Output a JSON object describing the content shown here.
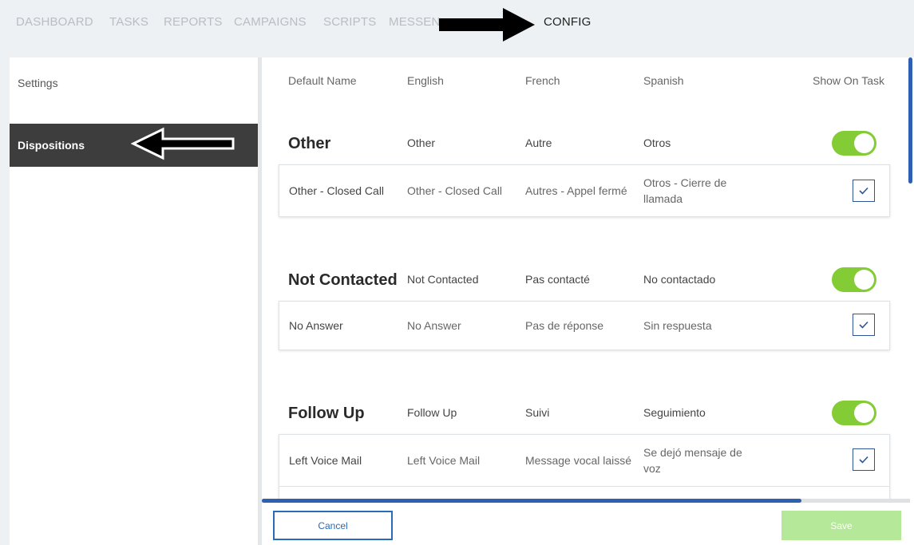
{
  "nav": {
    "items": [
      "DASHBOARD",
      "TASKS",
      "REPORTS",
      "CAMPAIGNS",
      "SCRIPTS",
      "MESSEN",
      "CONFIG"
    ]
  },
  "sidebar": {
    "items": [
      {
        "label": "Settings"
      },
      {
        "label": "Dispositions"
      }
    ]
  },
  "table": {
    "headers": [
      "Default Name",
      "English",
      "French",
      "Spanish",
      "Show On Task"
    ],
    "groups": [
      {
        "title": "Other",
        "english": "Other",
        "french": "Autre",
        "spanish": "Otros",
        "enabled": true,
        "rows": [
          {
            "name": "Other - Closed Call",
            "english": "Other - Closed Call",
            "french": "Autres - Appel fermé",
            "spanish": "Otros - Cierre de llamada",
            "checked": true
          }
        ]
      },
      {
        "title": "Not Contacted",
        "english": "Not Contacted",
        "french": "Pas contacté",
        "spanish": "No contactado",
        "enabled": true,
        "rows": [
          {
            "name": "No Answer",
            "english": "No Answer",
            "french": "Pas de réponse",
            "spanish": "Sin respuesta",
            "checked": true
          }
        ]
      },
      {
        "title": "Follow Up",
        "english": "Follow Up",
        "french": "Suivi",
        "spanish": "Seguimiento",
        "enabled": true,
        "rows": [
          {
            "name": "Left Voice Mail",
            "english": "Left Voice Mail",
            "french": "Message vocal laissé",
            "spanish": "Se dejó mensaje de voz",
            "checked": true
          }
        ]
      }
    ]
  },
  "footer": {
    "cancel_label": "Cancel",
    "save_label": "Save"
  },
  "colors": {
    "toggle_on": "#84cc35",
    "accent_blue": "#2a6bb5",
    "save_disabled": "#b6e89a",
    "active_sidebar": "#3d3d3d"
  }
}
